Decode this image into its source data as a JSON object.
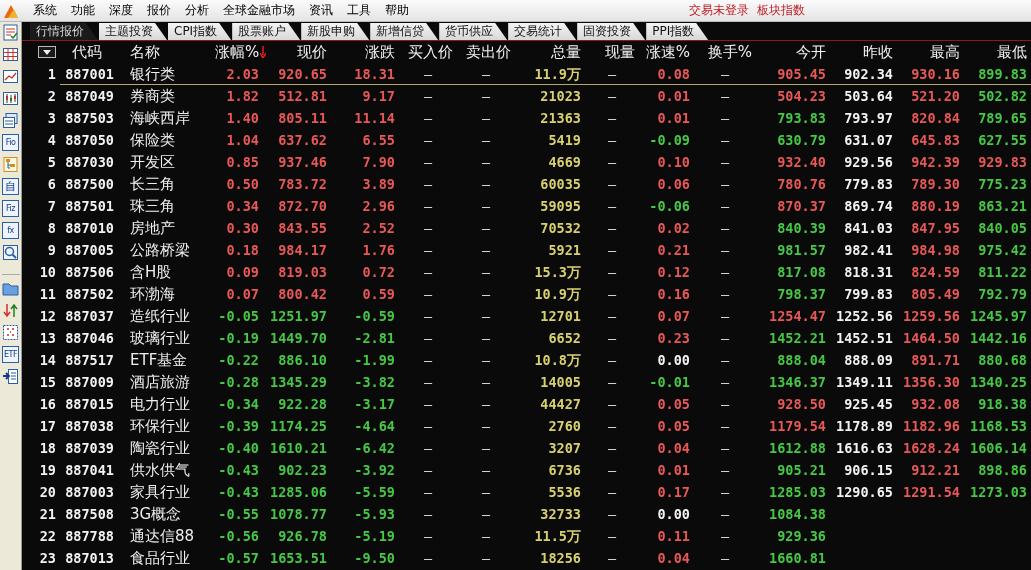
{
  "menu_bar": {
    "items": [
      "系统",
      "功能",
      "深度",
      "报价",
      "分析",
      "全球金融市场",
      "资讯",
      "工具",
      "帮助"
    ],
    "status": "交易未登录  板块指数"
  },
  "toolbar": [
    {
      "kind": "checklist"
    },
    {
      "kind": "grid"
    },
    {
      "kind": "line-chart"
    },
    {
      "kind": "candles"
    },
    {
      "kind": "windows"
    },
    {
      "kind": "label",
      "text": "Fio"
    },
    {
      "kind": "tree"
    },
    {
      "kind": "label",
      "text": "自"
    },
    {
      "kind": "label",
      "text": "Fiz"
    },
    {
      "kind": "label",
      "text": "fx"
    },
    {
      "kind": "search"
    },
    {
      "kind": "gap"
    },
    {
      "kind": "folder"
    },
    {
      "kind": "sort"
    },
    {
      "kind": "dots"
    },
    {
      "kind": "label",
      "text": "ETF"
    },
    {
      "kind": "import"
    }
  ],
  "tabs": [
    {
      "label": "行情报价",
      "selected": true
    },
    {
      "label": "主题投资",
      "selected": false
    },
    {
      "label": "CPI指数",
      "selected": false
    },
    {
      "label": "股票账户",
      "selected": false
    },
    {
      "label": "新股申购",
      "selected": false
    },
    {
      "label": "新增信贷",
      "selected": false
    },
    {
      "label": "货币供应",
      "selected": false
    },
    {
      "label": "交易统计",
      "selected": false
    },
    {
      "label": "固资投资",
      "selected": false
    },
    {
      "label": "PPI指数",
      "selected": false
    }
  ],
  "table": {
    "columns": [
      {
        "kind": "menu"
      },
      {
        "label": "代码"
      },
      {
        "label": "名称"
      },
      {
        "label": "涨幅%",
        "sorted_desc": true
      },
      {
        "label": "现价"
      },
      {
        "label": "涨跌"
      },
      {
        "label": "买入价"
      },
      {
        "label": "卖出价"
      },
      {
        "label": "总量"
      },
      {
        "label": "现量"
      },
      {
        "label": "涨速%"
      },
      {
        "label": "换手%"
      },
      {
        "label": "今开"
      },
      {
        "label": "昨收"
      },
      {
        "label": "最高"
      },
      {
        "label": "最低"
      }
    ],
    "rows": [
      {
        "selected": true,
        "rising": true,
        "speed_up": true,
        "speed_down": false,
        "open_up": true,
        "high_up": true,
        "low_up": false,
        "cells": [
          "1",
          "887001",
          "银行类",
          "2.03",
          "920.65",
          "18.31",
          "—",
          "—",
          "11.9万",
          "—",
          "0.08",
          "—",
          "905.45",
          "902.34",
          "930.16",
          "899.83"
        ]
      },
      {
        "selected": false,
        "rising": true,
        "speed_up": true,
        "speed_down": false,
        "open_up": true,
        "high_up": true,
        "low_up": false,
        "cells": [
          "2",
          "887049",
          "券商类",
          "1.82",
          "512.81",
          "9.17",
          "—",
          "—",
          "21023",
          "—",
          "0.01",
          "—",
          "504.23",
          "503.64",
          "521.20",
          "502.82"
        ]
      },
      {
        "selected": false,
        "rising": true,
        "speed_up": true,
        "speed_down": false,
        "open_up": false,
        "high_up": true,
        "low_up": false,
        "cells": [
          "3",
          "887503",
          "海峡西岸",
          "1.40",
          "805.11",
          "11.14",
          "—",
          "—",
          "21363",
          "—",
          "0.01",
          "—",
          "793.83",
          "793.97",
          "820.84",
          "789.65"
        ]
      },
      {
        "selected": false,
        "rising": true,
        "speed_up": false,
        "speed_down": true,
        "open_up": false,
        "high_up": true,
        "low_up": false,
        "cells": [
          "4",
          "887050",
          "保险类",
          "1.04",
          "637.62",
          "6.55",
          "—",
          "—",
          "5419",
          "—",
          "-0.09",
          "—",
          "630.79",
          "631.07",
          "645.83",
          "627.55"
        ]
      },
      {
        "selected": false,
        "rising": true,
        "speed_up": true,
        "speed_down": false,
        "open_up": true,
        "high_up": true,
        "low_up": true,
        "cells": [
          "5",
          "887030",
          "开发区",
          "0.85",
          "937.46",
          "7.90",
          "—",
          "—",
          "4669",
          "—",
          "0.10",
          "—",
          "932.40",
          "929.56",
          "942.39",
          "929.83"
        ]
      },
      {
        "selected": false,
        "rising": true,
        "speed_up": true,
        "speed_down": false,
        "open_up": true,
        "high_up": true,
        "low_up": false,
        "cells": [
          "6",
          "887500",
          "长三角",
          "0.50",
          "783.72",
          "3.89",
          "—",
          "—",
          "60035",
          "—",
          "0.06",
          "—",
          "780.76",
          "779.83",
          "789.30",
          "775.23"
        ]
      },
      {
        "selected": false,
        "rising": true,
        "speed_up": false,
        "speed_down": true,
        "open_up": true,
        "high_up": true,
        "low_up": false,
        "cells": [
          "7",
          "887501",
          "珠三角",
          "0.34",
          "872.70",
          "2.96",
          "—",
          "—",
          "59095",
          "—",
          "-0.06",
          "—",
          "870.37",
          "869.74",
          "880.19",
          "863.21"
        ]
      },
      {
        "selected": false,
        "rising": true,
        "speed_up": true,
        "speed_down": false,
        "open_up": false,
        "high_up": true,
        "low_up": false,
        "cells": [
          "8",
          "887010",
          "房地产",
          "0.30",
          "843.55",
          "2.52",
          "—",
          "—",
          "70532",
          "—",
          "0.02",
          "—",
          "840.39",
          "841.03",
          "847.95",
          "840.05"
        ]
      },
      {
        "selected": false,
        "rising": true,
        "speed_up": true,
        "speed_down": false,
        "open_up": false,
        "high_up": true,
        "low_up": false,
        "cells": [
          "9",
          "887005",
          "公路桥梁",
          "0.18",
          "984.17",
          "1.76",
          "—",
          "—",
          "5921",
          "—",
          "0.21",
          "—",
          "981.57",
          "982.41",
          "984.98",
          "975.42"
        ]
      },
      {
        "selected": false,
        "rising": true,
        "speed_up": true,
        "speed_down": false,
        "open_up": false,
        "high_up": true,
        "low_up": false,
        "cells": [
          "10",
          "887506",
          "含H股",
          "0.09",
          "819.03",
          "0.72",
          "—",
          "—",
          "15.3万",
          "—",
          "0.12",
          "—",
          "817.08",
          "818.31",
          "824.59",
          "811.22"
        ]
      },
      {
        "selected": false,
        "rising": true,
        "speed_up": true,
        "speed_down": false,
        "open_up": false,
        "high_up": true,
        "low_up": false,
        "cells": [
          "11",
          "887502",
          "环渤海",
          "0.07",
          "800.42",
          "0.59",
          "—",
          "—",
          "10.9万",
          "—",
          "0.16",
          "—",
          "798.37",
          "799.83",
          "805.49",
          "792.79"
        ]
      },
      {
        "selected": false,
        "rising": false,
        "speed_up": true,
        "speed_down": false,
        "open_up": true,
        "high_up": true,
        "low_up": false,
        "cells": [
          "12",
          "887037",
          "造纸行业",
          "-0.05",
          "1251.97",
          "-0.59",
          "—",
          "—",
          "12701",
          "—",
          "0.07",
          "—",
          "1254.47",
          "1252.56",
          "1259.56",
          "1245.97"
        ]
      },
      {
        "selected": false,
        "rising": false,
        "speed_up": true,
        "speed_down": false,
        "open_up": false,
        "high_up": true,
        "low_up": false,
        "cells": [
          "13",
          "887046",
          "玻璃行业",
          "-0.19",
          "1449.70",
          "-2.81",
          "—",
          "—",
          "6652",
          "—",
          "0.23",
          "—",
          "1452.21",
          "1452.51",
          "1464.50",
          "1442.16"
        ]
      },
      {
        "selected": false,
        "rising": false,
        "speed_up": false,
        "speed_down": false,
        "open_up": false,
        "high_up": true,
        "low_up": false,
        "cells": [
          "14",
          "887517",
          "ETF基金",
          "-0.22",
          "886.10",
          "-1.99",
          "—",
          "—",
          "10.8万",
          "—",
          "0.00",
          "—",
          "888.04",
          "888.09",
          "891.71",
          "880.68"
        ]
      },
      {
        "selected": false,
        "rising": false,
        "speed_up": false,
        "speed_down": true,
        "open_up": false,
        "high_up": true,
        "low_up": false,
        "cells": [
          "15",
          "887009",
          "酒店旅游",
          "-0.28",
          "1345.29",
          "-3.82",
          "—",
          "—",
          "14005",
          "—",
          "-0.01",
          "—",
          "1346.37",
          "1349.11",
          "1356.30",
          "1340.25"
        ]
      },
      {
        "selected": false,
        "rising": false,
        "speed_up": true,
        "speed_down": false,
        "open_up": true,
        "high_up": true,
        "low_up": false,
        "cells": [
          "16",
          "887015",
          "电力行业",
          "-0.34",
          "922.28",
          "-3.17",
          "—",
          "—",
          "44427",
          "—",
          "0.05",
          "—",
          "928.50",
          "925.45",
          "932.08",
          "918.38"
        ]
      },
      {
        "selected": false,
        "rising": false,
        "speed_up": true,
        "speed_down": false,
        "open_up": true,
        "high_up": true,
        "low_up": false,
        "cells": [
          "17",
          "887038",
          "环保行业",
          "-0.39",
          "1174.25",
          "-4.64",
          "—",
          "—",
          "2760",
          "—",
          "0.05",
          "—",
          "1179.54",
          "1178.89",
          "1182.96",
          "1168.53"
        ]
      },
      {
        "selected": false,
        "rising": false,
        "speed_up": true,
        "speed_down": false,
        "open_up": false,
        "high_up": true,
        "low_up": false,
        "cells": [
          "18",
          "887039",
          "陶瓷行业",
          "-0.40",
          "1610.21",
          "-6.42",
          "—",
          "—",
          "3207",
          "—",
          "0.04",
          "—",
          "1612.88",
          "1616.63",
          "1628.24",
          "1606.14"
        ]
      },
      {
        "selected": false,
        "rising": false,
        "speed_up": true,
        "speed_down": false,
        "open_up": false,
        "high_up": true,
        "low_up": false,
        "cells": [
          "19",
          "887041",
          "供水供气",
          "-0.43",
          "902.23",
          "-3.92",
          "—",
          "—",
          "6736",
          "—",
          "0.01",
          "—",
          "905.21",
          "906.15",
          "912.21",
          "898.86"
        ]
      },
      {
        "selected": false,
        "rising": false,
        "speed_up": true,
        "speed_down": false,
        "open_up": false,
        "high_up": true,
        "low_up": false,
        "cells": [
          "20",
          "887003",
          "家具行业",
          "-0.43",
          "1285.06",
          "-5.59",
          "—",
          "—",
          "5536",
          "—",
          "0.17",
          "—",
          "1285.03",
          "1290.65",
          "1291.54",
          "1273.03"
        ]
      },
      {
        "selected": false,
        "rising": false,
        "speed_up": false,
        "speed_down": false,
        "open_up": false,
        "cells": [
          "21",
          "887508",
          "3G概念",
          "-0.55",
          "1078.77",
          "-5.93",
          "—",
          "—",
          "32733",
          "—",
          "0.00",
          "—",
          "1084.38",
          null,
          null,
          null
        ]
      },
      {
        "selected": false,
        "rising": false,
        "speed_up": true,
        "speed_down": false,
        "open_up": false,
        "cells": [
          "22",
          "887788",
          "通达信88",
          "-0.56",
          "926.78",
          "-5.19",
          "—",
          "—",
          "11.5万",
          "—",
          "0.11",
          "—",
          "929.36",
          null,
          null,
          null
        ]
      },
      {
        "selected": false,
        "rising": false,
        "speed_up": true,
        "speed_down": false,
        "open_up": false,
        "cells": [
          "23",
          "887013",
          "食品行业",
          "-0.57",
          "1653.51",
          "-9.50",
          "—",
          "—",
          "18256",
          "—",
          "0.04",
          "—",
          "1660.81",
          null,
          null,
          null
        ]
      }
    ]
  }
}
